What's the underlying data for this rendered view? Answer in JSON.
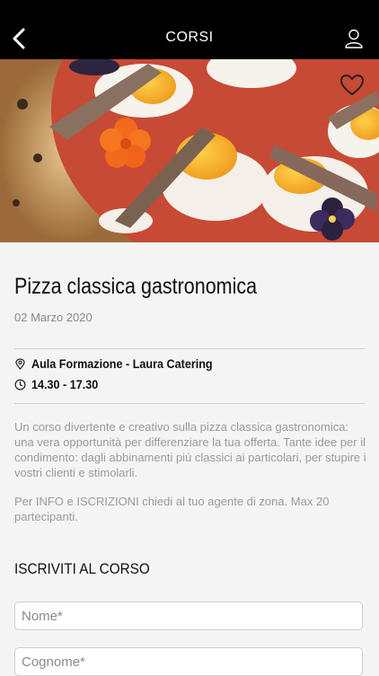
{
  "header": {
    "title": "CORSI",
    "back_icon": "chevron-left-icon",
    "user_icon": "user-icon"
  },
  "hero": {
    "favorite_icon": "heart-outline-icon"
  },
  "course": {
    "title": "Pizza classica gastronomica",
    "date": "02 Marzo 2020",
    "location": "Aula Formazione - Laura Catering",
    "time": "14.30 - 17.30",
    "description_1": "Un corso divertente e creativo sulla pizza classica gastronomica: una vera opportunità per differenziare la tua offerta. Tante idee per il condimento: dagli abbinamenti più classici ai particolari, per stupire i vostri clienti e stimolarli.",
    "description_2": "Per INFO e ISCRIZIONI chiedi al tuo agente di zona. Max 20 partecipanti."
  },
  "form": {
    "heading": "ISCRIVITI AL CORSO",
    "name_placeholder": "Nome*",
    "surname_placeholder": "Cognome*"
  },
  "colors": {
    "navbar": "#000000",
    "background": "#f4f4f4",
    "muted_text": "#9a9a9a"
  }
}
